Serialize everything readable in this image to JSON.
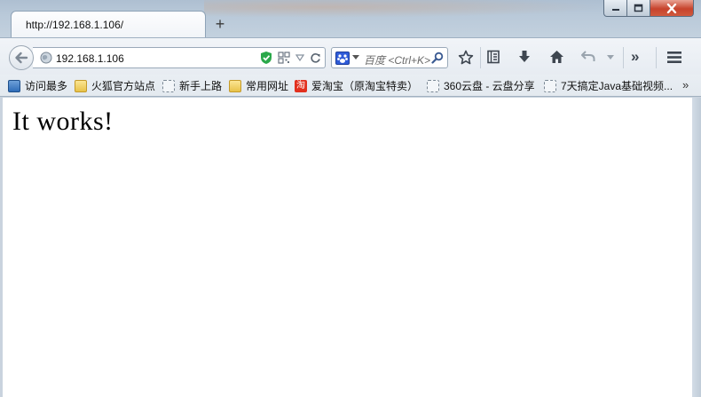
{
  "tab": {
    "title": "http://192.168.1.106/",
    "new_tab_label": "+"
  },
  "navbar": {
    "url": "192.168.1.106",
    "search_placeholder": "百度 <Ctrl+K>",
    "overflow_label": "»"
  },
  "bookmarks": {
    "items": [
      {
        "label": "访问最多",
        "icon": "most-visited-icon"
      },
      {
        "label": "火狐官方站点",
        "icon": "folder-icon"
      },
      {
        "label": "新手上路",
        "icon": "page-icon"
      },
      {
        "label": "常用网址",
        "icon": "folder-icon"
      },
      {
        "label": "爱淘宝（原淘宝特卖）",
        "icon": "taobao-icon",
        "icon_text": "淘"
      },
      {
        "label": "360云盘 - 云盘分享",
        "icon": "page-icon"
      },
      {
        "label": "7天搞定Java基础视频...",
        "icon": "page-icon"
      }
    ],
    "more_label": "»"
  },
  "content": {
    "heading": "It works!"
  },
  "colors": {
    "chrome_bg": "#c9d3de",
    "close_button": "#c7432c",
    "shield_green": "#2aa84a",
    "baidu_blue": "#2e5bd8",
    "taobao_red": "#e2301e"
  }
}
